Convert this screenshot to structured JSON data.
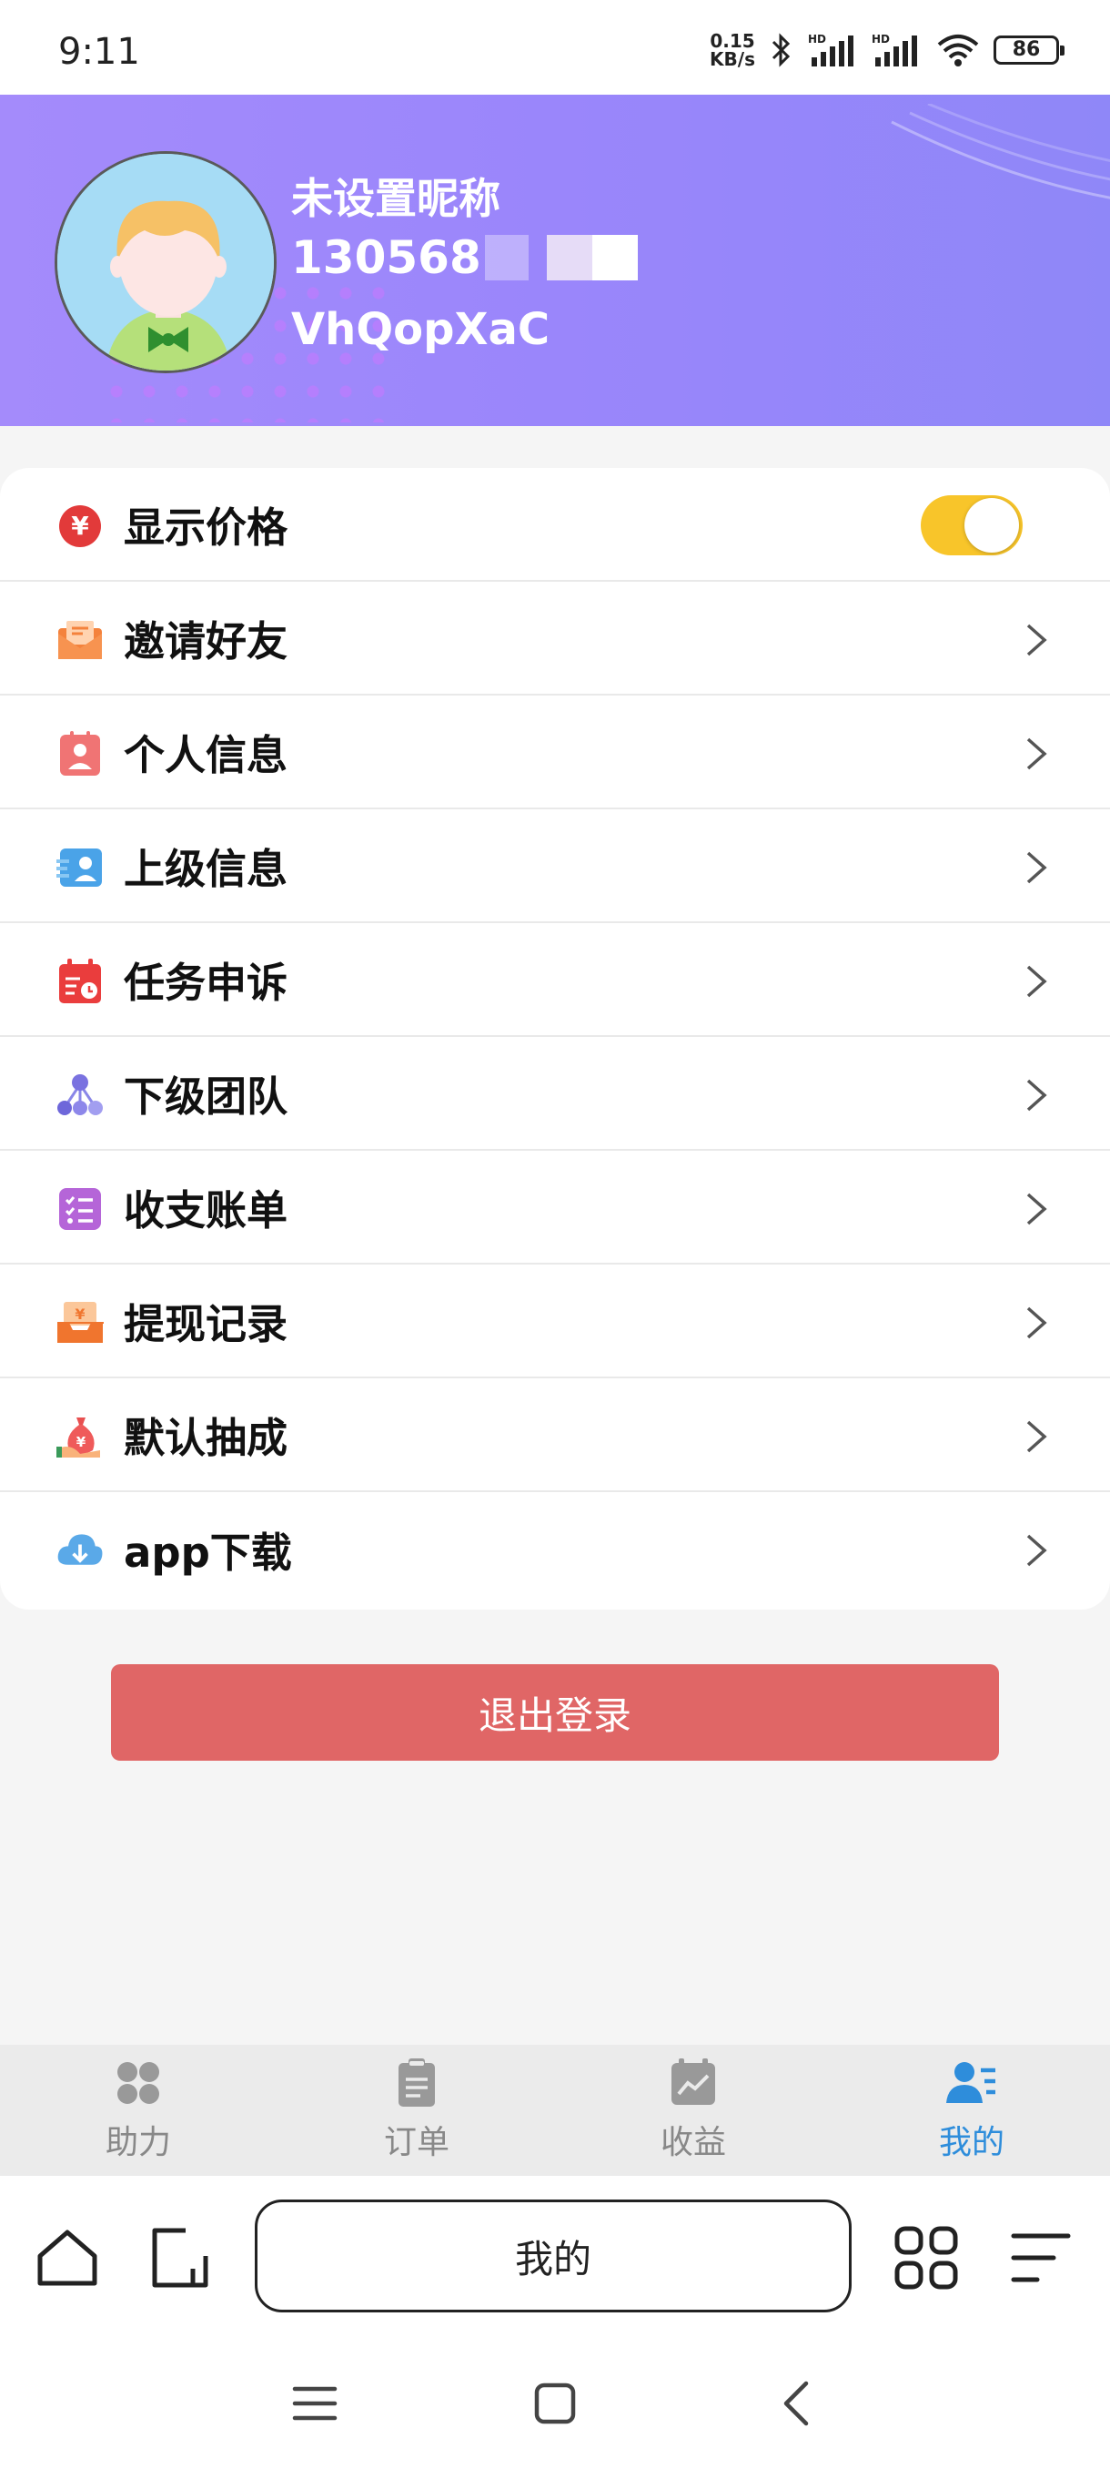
{
  "status_bar": {
    "time": "9:11",
    "speed_value": "0.15",
    "speed_unit": "KB/s",
    "battery": "86"
  },
  "profile": {
    "nickname": "未设置昵称",
    "phone": "130568",
    "code": "VhQopXaC"
  },
  "menu": {
    "items": [
      {
        "label": "显示价格",
        "icon": "yuan-icon",
        "control": "toggle",
        "toggle_on": true
      },
      {
        "label": "邀请好友",
        "icon": "envelope-icon"
      },
      {
        "label": "个人信息",
        "icon": "person-card-icon"
      },
      {
        "label": "上级信息",
        "icon": "superior-icon"
      },
      {
        "label": "任务申诉",
        "icon": "calendar-clock-icon"
      },
      {
        "label": "下级团队",
        "icon": "team-tree-icon"
      },
      {
        "label": "收支账单",
        "icon": "bill-list-icon"
      },
      {
        "label": "提现记录",
        "icon": "withdraw-box-icon"
      },
      {
        "label": "默认抽成",
        "icon": "money-bag-icon"
      },
      {
        "label": "app下载",
        "icon": "cloud-download-icon"
      }
    ]
  },
  "logout_label": "退出登录",
  "tabs": [
    {
      "label": "助力",
      "icon": "grid-flower-icon",
      "active": false
    },
    {
      "label": "订单",
      "icon": "clipboard-icon",
      "active": false
    },
    {
      "label": "收益",
      "icon": "chart-box-icon",
      "active": false
    },
    {
      "label": "我的",
      "icon": "user-list-icon",
      "active": true
    }
  ],
  "browser": {
    "address_text": "我的"
  },
  "colors": {
    "header_gradient_start": "#a48bfb",
    "header_gradient_end": "#8f87f8",
    "toggle_on": "#f8c52a",
    "logout_bg": "#e06666",
    "tab_active": "#2e8ddb",
    "tab_inactive": "#888888"
  }
}
